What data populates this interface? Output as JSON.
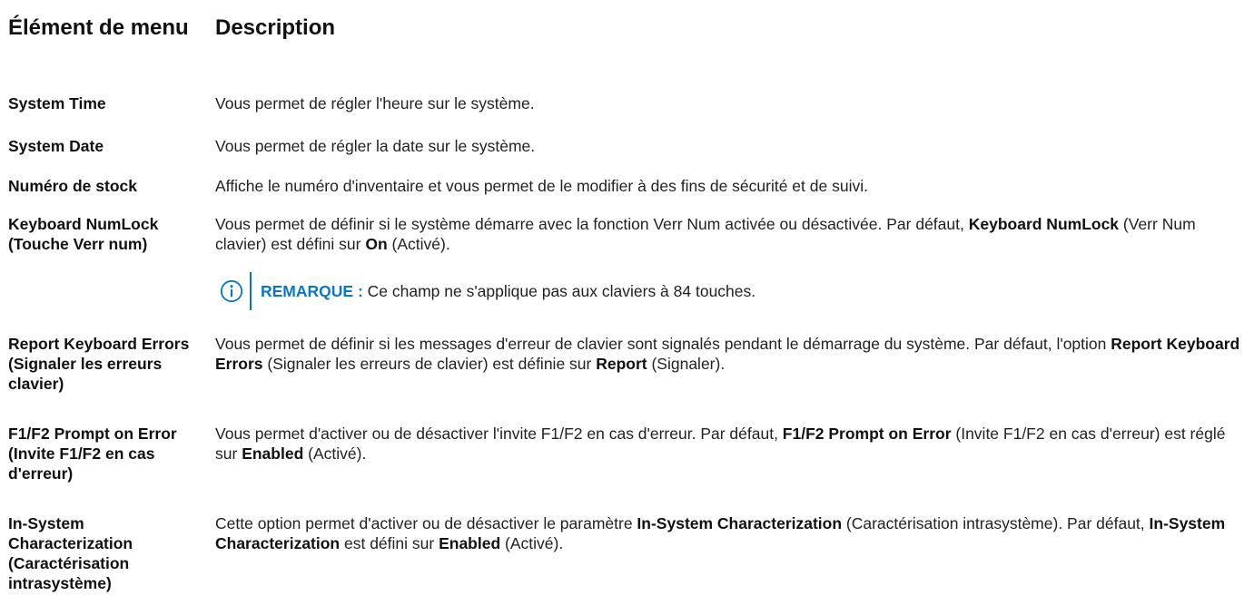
{
  "headers": {
    "menu_item": "Élément de menu",
    "description": "Description"
  },
  "rows": [
    {
      "term": "System Time",
      "desc": "Vous permet de régler l'heure sur le système."
    },
    {
      "term": "System Date",
      "desc": "Vous permet de régler la date sur le système."
    },
    {
      "term": "Numéro de stock",
      "desc": "Affiche le numéro d'inventaire et vous permet de le modifier à des fins de sécurité et de suivi."
    },
    {
      "term": "Keyboard NumLock (Touche Verr num)",
      "desc": {
        "t1": "Vous permet de définir si le système démarre avec la fonction Verr Num activée ou désactivée. Par défaut, ",
        "b1": "Keyboard NumLock",
        "t2": " (Verr Num clavier) est défini sur ",
        "b2": "On",
        "t3": " (Activé)."
      }
    },
    {
      "term": "Report Keyboard Errors (Signaler les erreurs clavier)",
      "desc": {
        "t1": "Vous permet de définir si les messages d'erreur de clavier sont signalés pendant le démarrage du système. Par défaut, l'option ",
        "b1": "Report Keyboard Errors",
        "t2": " (Signaler les erreurs de clavier) est définie sur ",
        "b2": "Report",
        "t3": " (Signaler)."
      }
    },
    {
      "term": "F1/F2 Prompt on Error (Invite F1/F2 en cas d'erreur)",
      "desc": {
        "t1": "Vous permet d'activer ou de désactiver l'invite F1/F2 en cas d'erreur. Par défaut, ",
        "b1": "F1/F2 Prompt on Error",
        "t2": " (Invite F1/F2 en cas d'erreur) est réglé sur ",
        "b2": "Enabled",
        "t3": " (Activé)."
      }
    },
    {
      "term": "In-System Characterization (Caractérisation intrasystème)",
      "desc": {
        "t1": "Cette option permet d'activer ou de désactiver le paramètre ",
        "b1": "In-System Characterization",
        "t2": " (Caractérisation intrasystème). Par défaut, ",
        "b2": "In-System Characterization",
        "t3": " est défini sur ",
        "b3": "Enabled",
        "t4": " (Activé)."
      }
    }
  ],
  "note": {
    "icon": "info-icon",
    "label": "REMARQUE :",
    "text": " Ce champ ne s'applique pas aux claviers à 84 touches.",
    "accent": "#0b76c9"
  }
}
